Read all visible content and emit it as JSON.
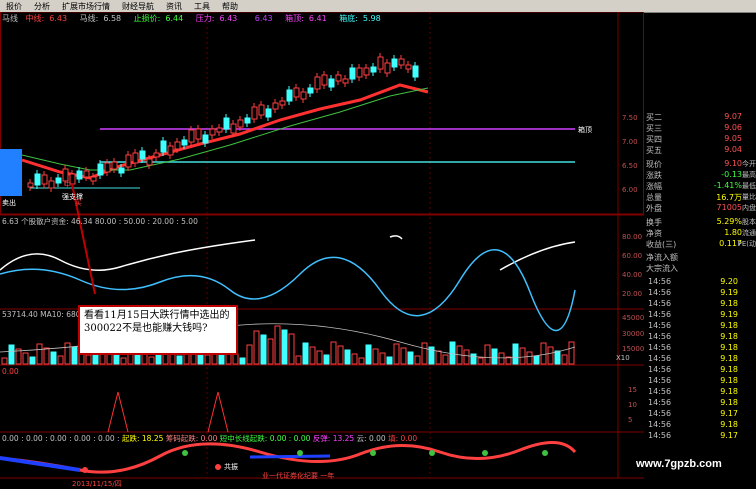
{
  "menu": [
    "报价",
    "分析",
    "扩展市场行情",
    "财经导航",
    "资讯",
    "工具",
    "帮助"
  ],
  "legend": {
    "main_label": "马线",
    "items": [
      {
        "label": "中线:",
        "value": "6.43",
        "color": "#ff4040"
      },
      {
        "label": "马线:",
        "value": "6.58",
        "color": "#c0c0c0"
      },
      {
        "label": "止损价:",
        "value": "6.44",
        "color": "#40ff40"
      },
      {
        "label": "压力:",
        "value": "6.43",
        "color": "#ff40ff"
      },
      {
        "label": "",
        "value": "6.43",
        "color": "#c040ff"
      },
      {
        "label": "箱顶:",
        "value": "6.41",
        "color": "#ff40ff"
      },
      {
        "label": "箱底:",
        "value": "5.98",
        "color": "#40ffff"
      }
    ]
  },
  "price_axis": [
    "7.50",
    "7.00",
    "6.50",
    "6.00"
  ],
  "box_top_label": "箱顶",
  "sell_label": "卖出",
  "support_label": "强支撑",
  "chart_annotations": [
    "中",
    "买"
  ],
  "panel2": {
    "title": "6.63  个股散户资金: 46.34  80.00 : 50.00 : 20.00 : 5.00",
    "axis": [
      "80.00",
      "60.00",
      "40.00",
      "20.00"
    ]
  },
  "panel3": {
    "title": "53714.40  MA10: 68006.59",
    "axis": [
      "45000",
      "30000",
      "15000"
    ],
    "unit": "X10"
  },
  "panel4": {
    "left_value": "0.00",
    "axis": [
      "15",
      "10",
      "5"
    ]
  },
  "panel5": {
    "title_parts": [
      {
        "text": "0.00 : 0.00 : 0.00 : 0.00 : 0.00 :",
        "color": "#c0c0c0"
      },
      {
        "text": "起跌: 18.25",
        "color": "#ffff00"
      },
      {
        "text": "筹码起跌: 0.00",
        "color": "#ff8080"
      },
      {
        "text": "短中长线起跌: 0.00 : 0.00",
        "color": "#40ff40"
      },
      {
        "text": "反弹: 13.25",
        "color": "#ff40ff"
      },
      {
        "text": "云: 0.00",
        "color": "#c0c0c0"
      },
      {
        "text": "填: 0.00",
        "color": "#ff4040"
      }
    ],
    "flag_label": "共振",
    "bottom_label": "业一代证券化纪要 一年"
  },
  "date_label": "2013/11/15/四",
  "callout_text": "看看11月15日大跌行情中选出的300022不是也能赚大钱吗?",
  "quote": [
    {
      "label": "买二",
      "value": "9.07",
      "extra": ""
    },
    {
      "label": "买三",
      "value": "9.06",
      "extra": ""
    },
    {
      "label": "买四",
      "value": "9.05",
      "extra": ""
    },
    {
      "label": "买五",
      "value": "9.04",
      "extra": ""
    },
    {
      "label": "现价",
      "value": "9.10",
      "extra": "今开"
    },
    {
      "label": "涨跌",
      "value": "-0.13",
      "extra": "最高"
    },
    {
      "label": "涨幅",
      "value": "-1.41%",
      "extra": "最低"
    },
    {
      "label": "总量",
      "value": "16.7万",
      "extra": "量比"
    },
    {
      "label": "外盘",
      "value": "71005",
      "extra": "内盘"
    },
    {
      "label": "换手",
      "value": "5.29%",
      "extra": "股本"
    },
    {
      "label": "净资",
      "value": "1.80",
      "extra": "流通"
    },
    {
      "label": "收益(三)",
      "value": "0.117",
      "extra": "PE(动"
    },
    {
      "label": "净流入额",
      "value": "",
      "extra": ""
    },
    {
      "label": "大宗流入",
      "value": "",
      "extra": ""
    }
  ],
  "ticks": [
    {
      "time": "14:56",
      "price": "9.20"
    },
    {
      "time": "14:56",
      "price": "9.19"
    },
    {
      "time": "14:56",
      "price": "9.18"
    },
    {
      "time": "14:56",
      "price": "9.19"
    },
    {
      "time": "14:56",
      "price": "9.18"
    },
    {
      "time": "14:56",
      "price": "9.18"
    },
    {
      "time": "14:56",
      "price": "9.18"
    },
    {
      "time": "14:56",
      "price": "9.18"
    },
    {
      "time": "14:56",
      "price": "9.18"
    },
    {
      "time": "14:56",
      "price": "9.18"
    },
    {
      "time": "14:56",
      "price": "9.18"
    },
    {
      "time": "14:56",
      "price": "9.18"
    },
    {
      "time": "14:56",
      "price": "9.17"
    },
    {
      "time": "14:56",
      "price": "9.18"
    },
    {
      "time": "14:56",
      "price": "9.17"
    }
  ],
  "watermark": "www.7gpzb.com"
}
